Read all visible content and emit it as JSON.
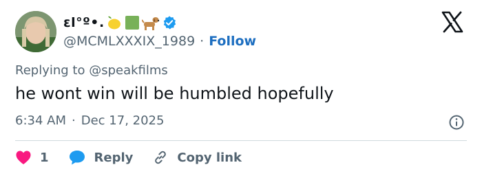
{
  "user": {
    "display_name": "ɛl°º•.",
    "display_emojis": [
      "lemon-emoji",
      "green-square-emoji",
      "dog-emoji"
    ],
    "verified": true,
    "handle": "@MCMLXXXIX_1989",
    "separator": "·",
    "follow_label": "Follow"
  },
  "reply_context": {
    "prefix": "Replying to",
    "mention": "@speakfilms"
  },
  "tweet": {
    "text": "he wont win will be humbled hopefully",
    "time": "6:34 AM",
    "separator": "·",
    "date": "Dec 17, 2025"
  },
  "actions": {
    "like_count": "1",
    "reply_label": "Reply",
    "copy_label": "Copy link"
  },
  "colors": {
    "like": "#f91880",
    "reply": "#1d9bf0",
    "verified": "#1d9bf0",
    "follow": "#1d6ec0",
    "muted": "#536471"
  },
  "icons": [
    "x-logo-icon",
    "verified-badge-icon",
    "info-icon",
    "heart-icon",
    "reply-bubble-icon",
    "link-icon"
  ]
}
